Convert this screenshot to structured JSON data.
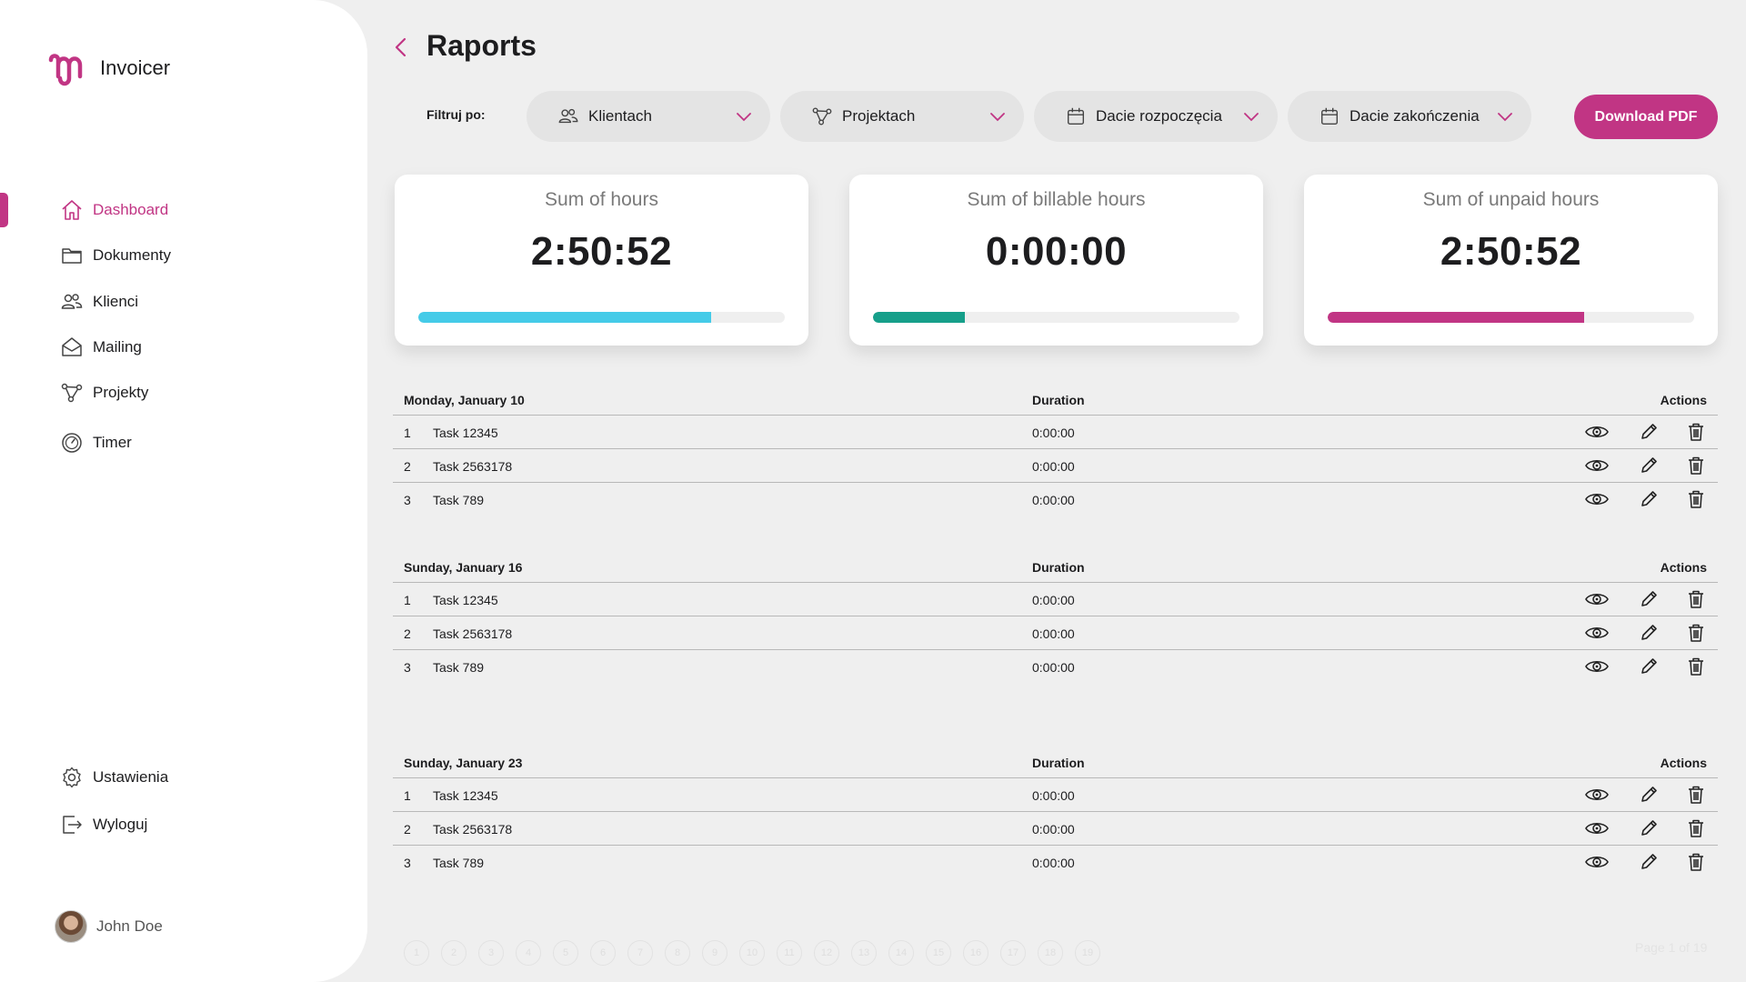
{
  "app": {
    "name": "Invoicer"
  },
  "sidebar": {
    "items": [
      {
        "label": "Dashboard",
        "icon": "home-icon",
        "active": true
      },
      {
        "label": "Dokumenty",
        "icon": "folder-icon"
      },
      {
        "label": "Klienci",
        "icon": "users-icon"
      },
      {
        "label": "Mailing",
        "icon": "mail-icon"
      },
      {
        "label": "Projekty",
        "icon": "share-nodes-icon"
      },
      {
        "label": "Timer",
        "icon": "timer-icon"
      }
    ],
    "bottom": [
      {
        "label": "Ustawienia",
        "icon": "gear-icon"
      },
      {
        "label": "Wyloguj",
        "icon": "logout-icon"
      }
    ],
    "user": {
      "name": "John Doe"
    }
  },
  "header": {
    "title": "Raports",
    "filter_label": "Filtruj po:",
    "filters": [
      {
        "label": "Klientach",
        "icon": "users-icon"
      },
      {
        "label": "Projektach",
        "icon": "share-nodes-icon"
      },
      {
        "label": "Dacie rozpoczęcia",
        "icon": "calendar-icon"
      },
      {
        "label": "Dacie zakończenia",
        "icon": "calendar-icon"
      }
    ],
    "download_label": "Download PDF"
  },
  "stats": [
    {
      "label": "Sum of hours",
      "value": "2:50:52",
      "progress": 0.8,
      "color": "#45cbe8"
    },
    {
      "label": "Sum of billable hours",
      "value": "0:00:00",
      "progress": 0.25,
      "color": "#169f8a"
    },
    {
      "label": "Sum of unpaid hours",
      "value": "2:50:52",
      "progress": 0.7,
      "color": "#c13584"
    }
  ],
  "table_headers": {
    "duration": "Duration",
    "actions": "Actions"
  },
  "groups": [
    {
      "date": "Monday, January 10",
      "rows": [
        {
          "num": "1",
          "task": "Task 12345",
          "duration": "0:00:00"
        },
        {
          "num": "2",
          "task": "Task 2563178",
          "duration": "0:00:00"
        },
        {
          "num": "3",
          "task": "Task 789",
          "duration": "0:00:00"
        }
      ]
    },
    {
      "date": "Sunday, January 16",
      "rows": [
        {
          "num": "1",
          "task": "Task 12345",
          "duration": "0:00:00"
        },
        {
          "num": "2",
          "task": "Task 2563178",
          "duration": "0:00:00"
        },
        {
          "num": "3",
          "task": "Task 789",
          "duration": "0:00:00"
        }
      ]
    },
    {
      "date": "Sunday, January 23",
      "rows": [
        {
          "num": "1",
          "task": "Task 12345",
          "duration": "0:00:00"
        },
        {
          "num": "2",
          "task": "Task 2563178",
          "duration": "0:00:00"
        },
        {
          "num": "3",
          "task": "Task 789",
          "duration": "0:00:00"
        }
      ]
    }
  ],
  "pagination": {
    "pages": [
      "1",
      "2",
      "3",
      "4",
      "5",
      "6",
      "7",
      "8",
      "9",
      "10",
      "11",
      "12",
      "13",
      "14",
      "15",
      "16",
      "17",
      "18",
      "19"
    ],
    "info": "Page 1 of 19"
  },
  "colors": {
    "accent": "#c13584",
    "background": "#efefef"
  }
}
